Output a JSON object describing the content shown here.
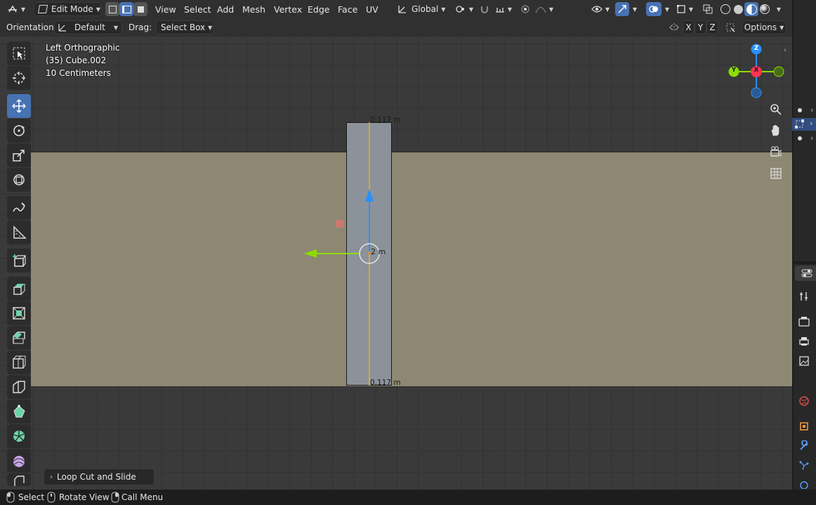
{
  "header": {
    "mode": "Edit Mode",
    "menus": [
      "View",
      "Select",
      "Add",
      "Mesh",
      "Vertex",
      "Edge",
      "Face",
      "UV"
    ],
    "transform_orientation": "Global"
  },
  "tool_header": {
    "orientation_label": "Orientation:",
    "orientation_value": "Default",
    "drag_label": "Drag:",
    "drag_value": "Select Box",
    "axis_x": "X",
    "axis_y": "Y",
    "axis_z": "Z",
    "options": "Options"
  },
  "viewport": {
    "view_name": "Left Orthographic",
    "object_name": "(35) Cube.002",
    "grid_scale": "10 Centimeters",
    "measure_top": "0.117 m",
    "measure_bottom": "0.117 m",
    "measure_center": "2 m"
  },
  "gizmo": {
    "z": "Z",
    "y": "Y",
    "x": "X"
  },
  "redo_panel": {
    "label": "Loop Cut and Slide"
  },
  "status_bar": {
    "select": "Select",
    "rotate": "Rotate View",
    "call_menu": "Call Menu"
  },
  "colors": {
    "active_tool": "#4772b3",
    "axis_x": "#ff3352",
    "axis_y": "#8bdc00",
    "axis_z": "#2890ff",
    "edge_highlight": "#ffb400"
  }
}
